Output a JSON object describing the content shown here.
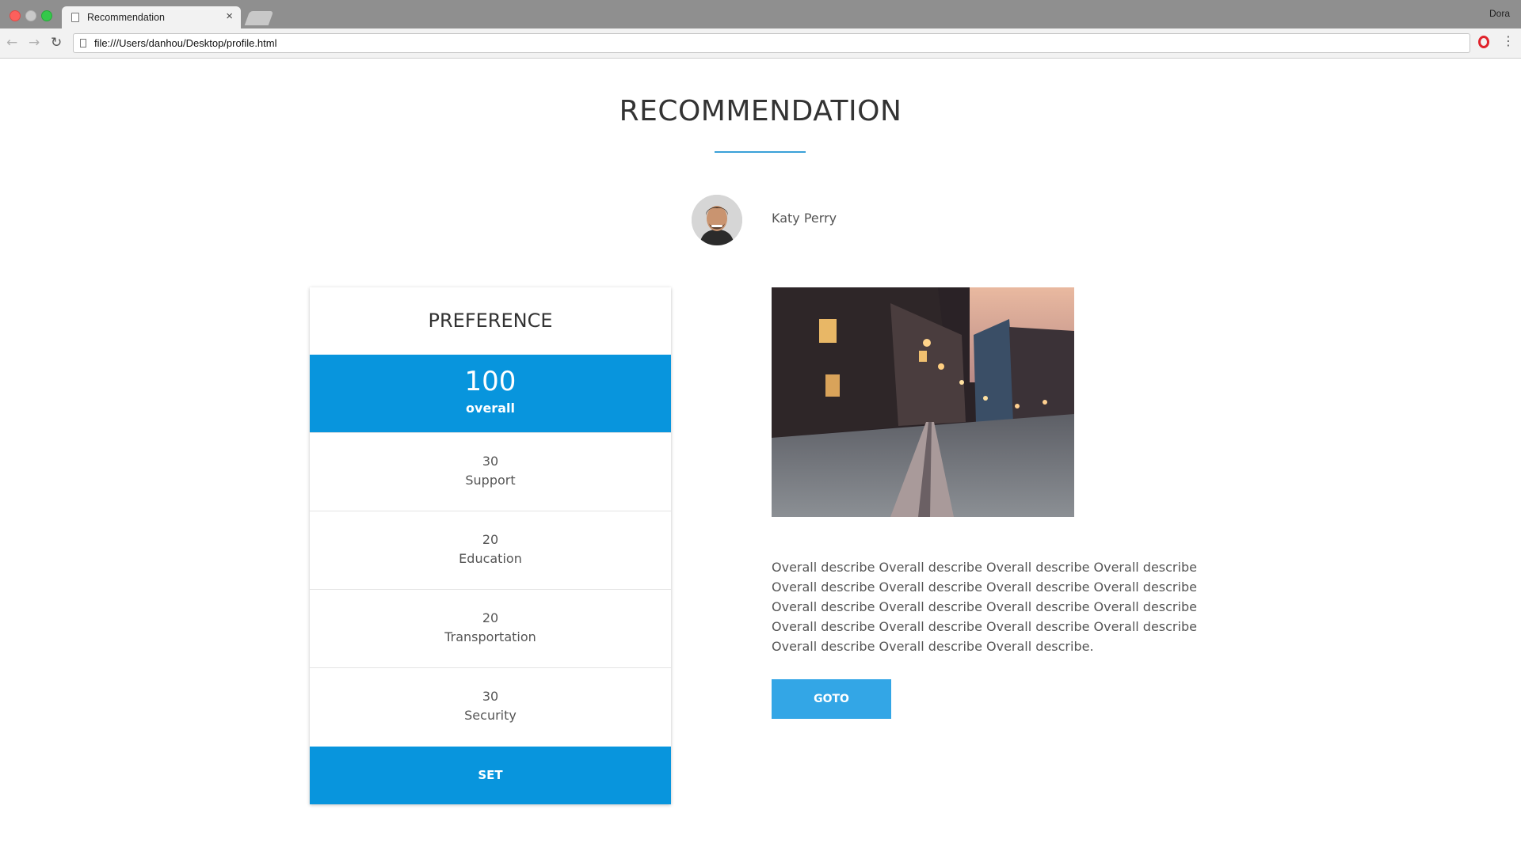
{
  "browser": {
    "tab_title": "Recommendation",
    "tab_close": "×",
    "profile": "Dora",
    "url": "file:///Users/danhou/Desktop/profile.html"
  },
  "page": {
    "title": "RECOMMENDATION",
    "user_name": "Katy Perry"
  },
  "preference": {
    "heading": "PREFERENCE",
    "overall_value": "100",
    "overall_label": "overall",
    "items": [
      {
        "value": "30",
        "label": "Support"
      },
      {
        "value": "20",
        "label": "Education"
      },
      {
        "value": "20",
        "label": "Transportation"
      },
      {
        "value": "30",
        "label": "Security"
      }
    ],
    "set_label": "SET"
  },
  "content": {
    "description": "Overall describe Overall describe Overall describe Overall describe Overall describe Overall describe Overall describe Overall describe Overall describe Overall describe Overall describe Overall describe Overall describe Overall describe Overall describe Overall describe Overall describe Overall describe Overall describe.",
    "goto_label": "GOTO"
  },
  "colors": {
    "accent": "#0895dd",
    "button": "#33a6e6",
    "title_rule": "#3aa0d8"
  }
}
